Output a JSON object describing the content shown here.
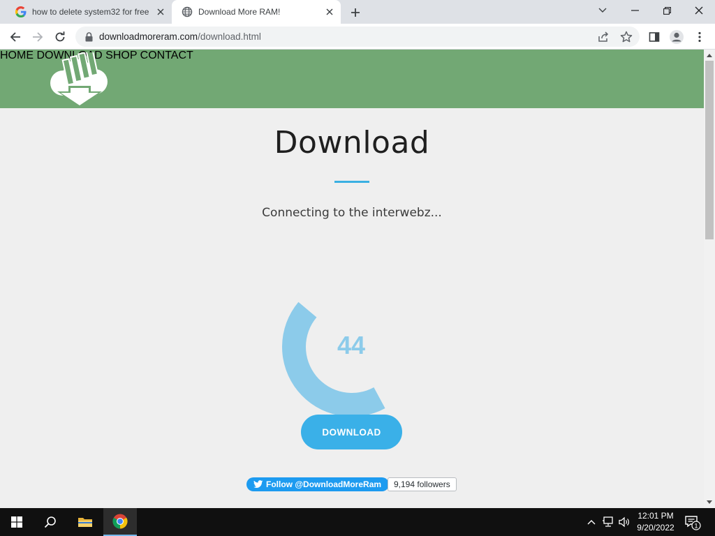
{
  "browser": {
    "tabs": [
      {
        "title": "how to delete system32 for free",
        "favicon": "google-g-icon",
        "active": false
      },
      {
        "title": "Download More RAM!",
        "favicon": "globe-icon",
        "active": true
      }
    ],
    "url_host": "downloadmoreram.com",
    "url_path": "/download.html"
  },
  "site": {
    "nav": [
      "HOME",
      "DOWNLOAD",
      "SHOP",
      "CONTACT"
    ],
    "heading": "Download",
    "status": "Connecting to the interwebz...",
    "progress": {
      "value": 44,
      "label": "44",
      "color": "#8ccbea"
    },
    "download_button": "DOWNLOAD",
    "twitter": {
      "follow": "Follow @DownloadMoreRam",
      "followers": "9,194 followers"
    },
    "colors": {
      "header": "#72a874",
      "accent": "#3ab0e2",
      "button": "#3ab0e8"
    }
  },
  "taskbar": {
    "time": "12:01 PM",
    "date": "9/20/2022",
    "notification_count": "1"
  }
}
